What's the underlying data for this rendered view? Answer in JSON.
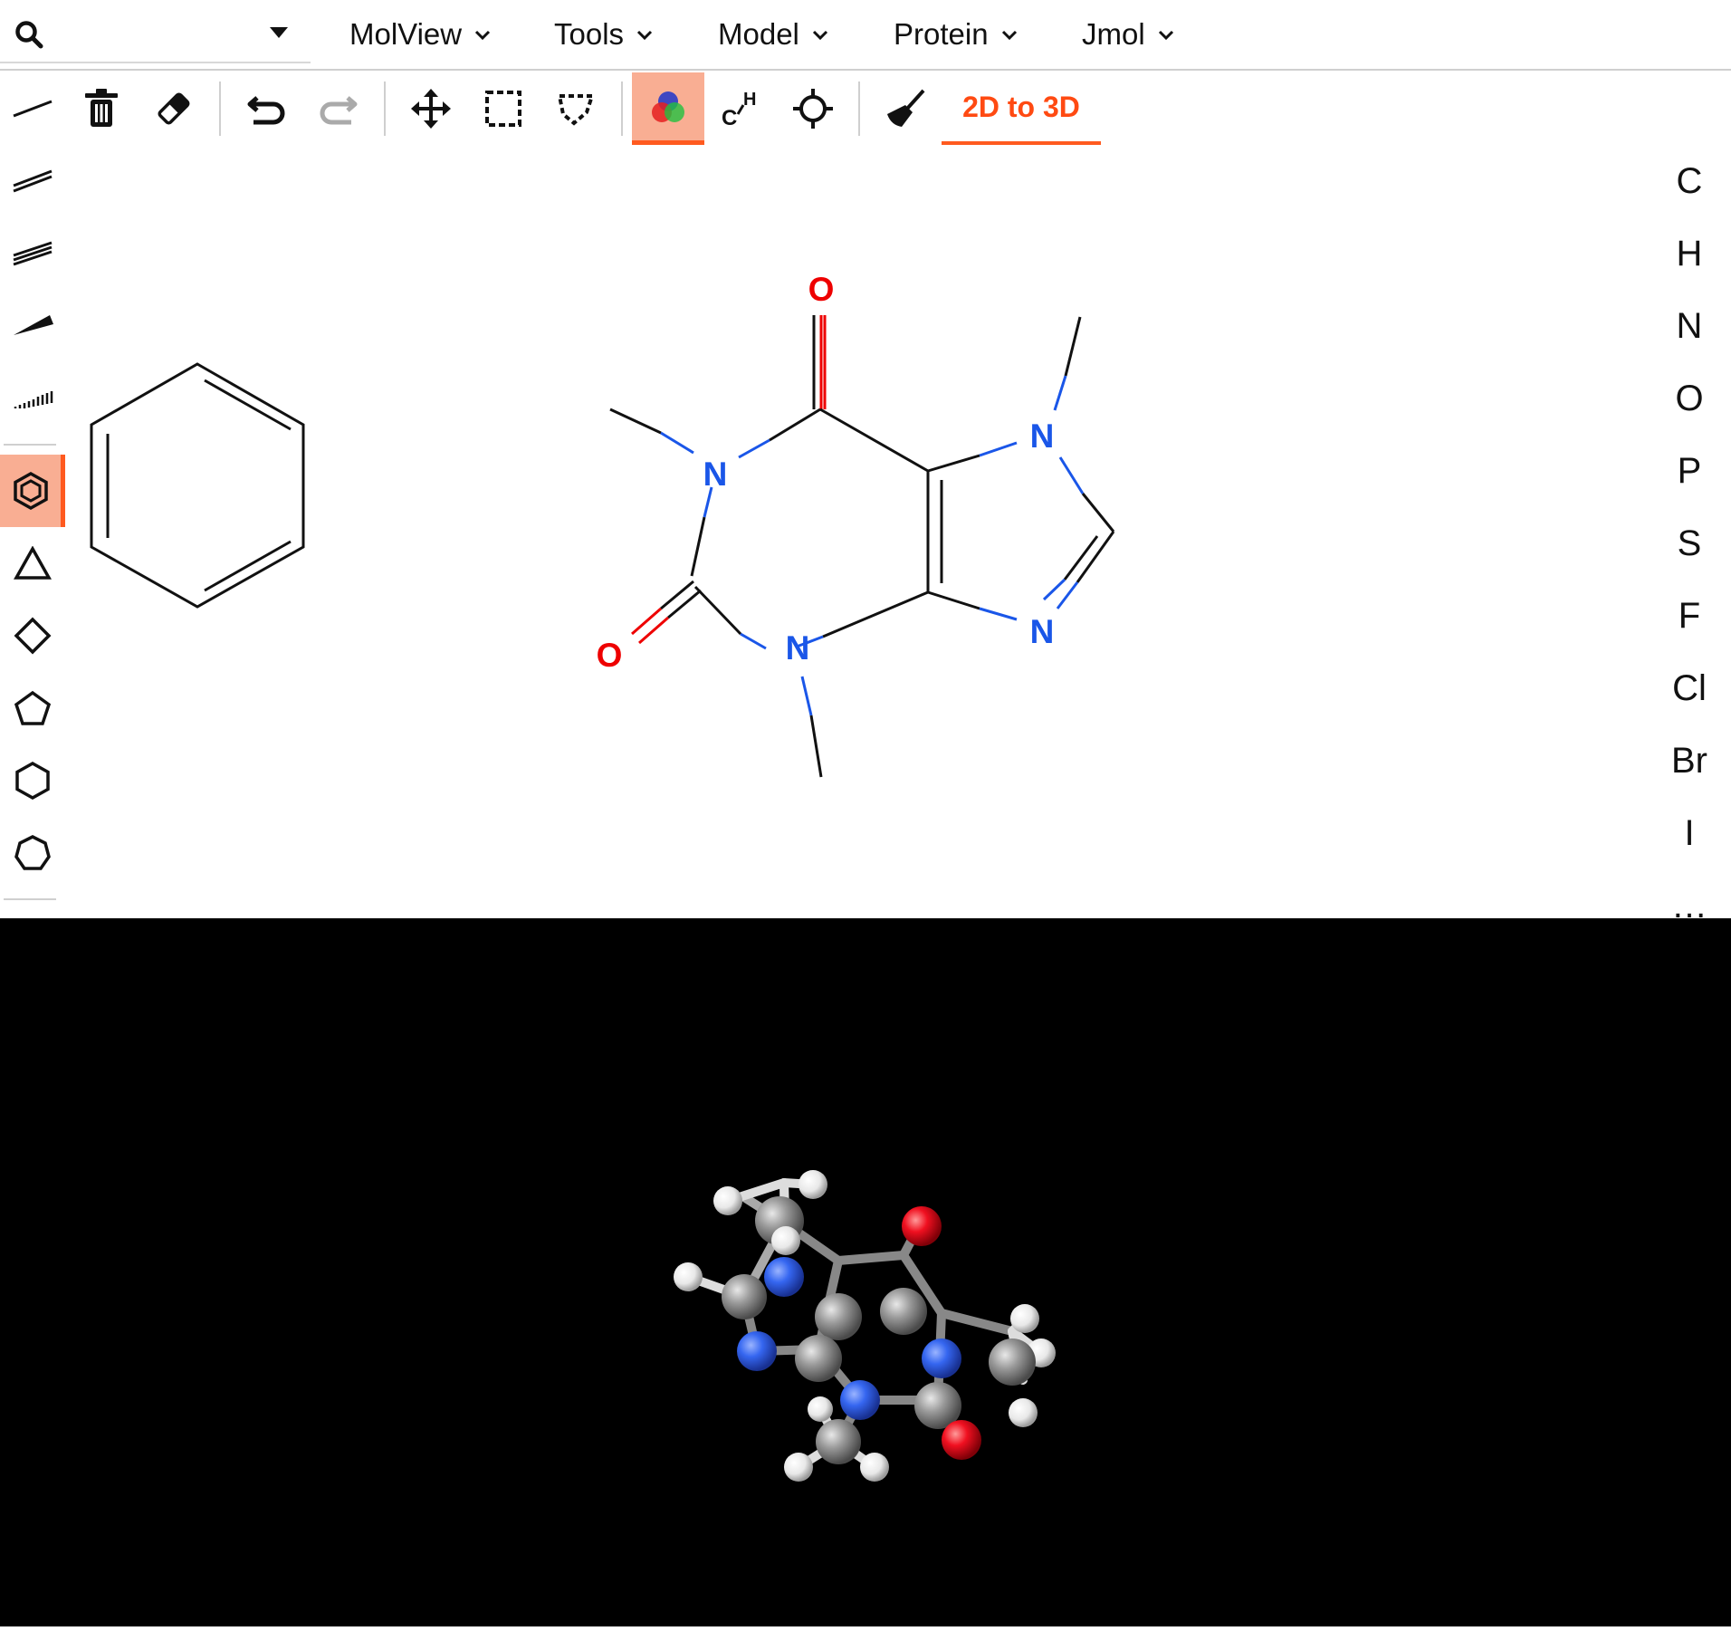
{
  "menubar": {
    "search": {
      "icon": "search-icon",
      "dropdown_icon": "caret-down-icon",
      "value": ""
    },
    "menus": [
      {
        "label": "MolView"
      },
      {
        "label": "Tools"
      },
      {
        "label": "Model"
      },
      {
        "label": "Protein"
      },
      {
        "label": "Jmol"
      }
    ]
  },
  "toolbar": {
    "tools": [
      {
        "name": "single-bond-tool",
        "icon": "single-bond-icon"
      },
      {
        "name": "clear-all-tool",
        "icon": "trash-icon"
      },
      {
        "name": "eraser-tool",
        "icon": "eraser-icon"
      },
      {
        "name": "undo-tool",
        "icon": "undo-icon"
      },
      {
        "name": "redo-tool",
        "icon": "redo-icon",
        "disabled": true
      },
      {
        "name": "drag-tool",
        "icon": "move-icon"
      },
      {
        "name": "rect-select-tool",
        "icon": "rect-select-icon"
      },
      {
        "name": "lasso-select-tool",
        "icon": "lasso-icon"
      },
      {
        "name": "color-mode-tool",
        "icon": "color-mode-icon",
        "active": true
      },
      {
        "name": "skeletal-display-tool",
        "icon": "skeletal-icon"
      },
      {
        "name": "center-tool",
        "icon": "crosshair-icon"
      },
      {
        "name": "clean-tool",
        "icon": "broom-icon"
      }
    ],
    "convert_label": "2D to 3D"
  },
  "left_tools": [
    {
      "name": "single-bond",
      "icon": "single-bond-icon"
    },
    {
      "name": "double-bond",
      "icon": "double-bond-icon"
    },
    {
      "name": "triple-bond",
      "icon": "triple-bond-icon"
    },
    {
      "name": "wedge-bond",
      "icon": "wedge-bond-icon"
    },
    {
      "name": "hash-bond",
      "icon": "hash-bond-icon"
    },
    {
      "name": "benzene",
      "icon": "benzene-icon",
      "active": true
    },
    {
      "name": "cyclopropane",
      "icon": "triangle-icon"
    },
    {
      "name": "cyclobutane",
      "icon": "square-icon"
    },
    {
      "name": "cyclopentane",
      "icon": "pentagon-icon"
    },
    {
      "name": "cyclohexane",
      "icon": "hexagon-icon"
    },
    {
      "name": "cycloheptane",
      "icon": "heptagon-icon"
    }
  ],
  "elements": [
    "C",
    "H",
    "N",
    "O",
    "P",
    "S",
    "F",
    "Cl",
    "Br",
    "I",
    "…"
  ],
  "sketch": {
    "atom_labels": {
      "O": "O",
      "N": "N"
    },
    "colors": {
      "carbon_bond": "#111111",
      "nitrogen": "#1a56e8",
      "oxygen": "#ee0000"
    }
  },
  "viewer3d": {
    "background": "#000000",
    "colors": {
      "C": "#909090",
      "H": "#f0f0f0",
      "N": "#3050f8",
      "O": "#ff0d0d"
    }
  },
  "theme": {
    "accent": "#ff5a1f",
    "accent_bg": "#f9ae93"
  }
}
